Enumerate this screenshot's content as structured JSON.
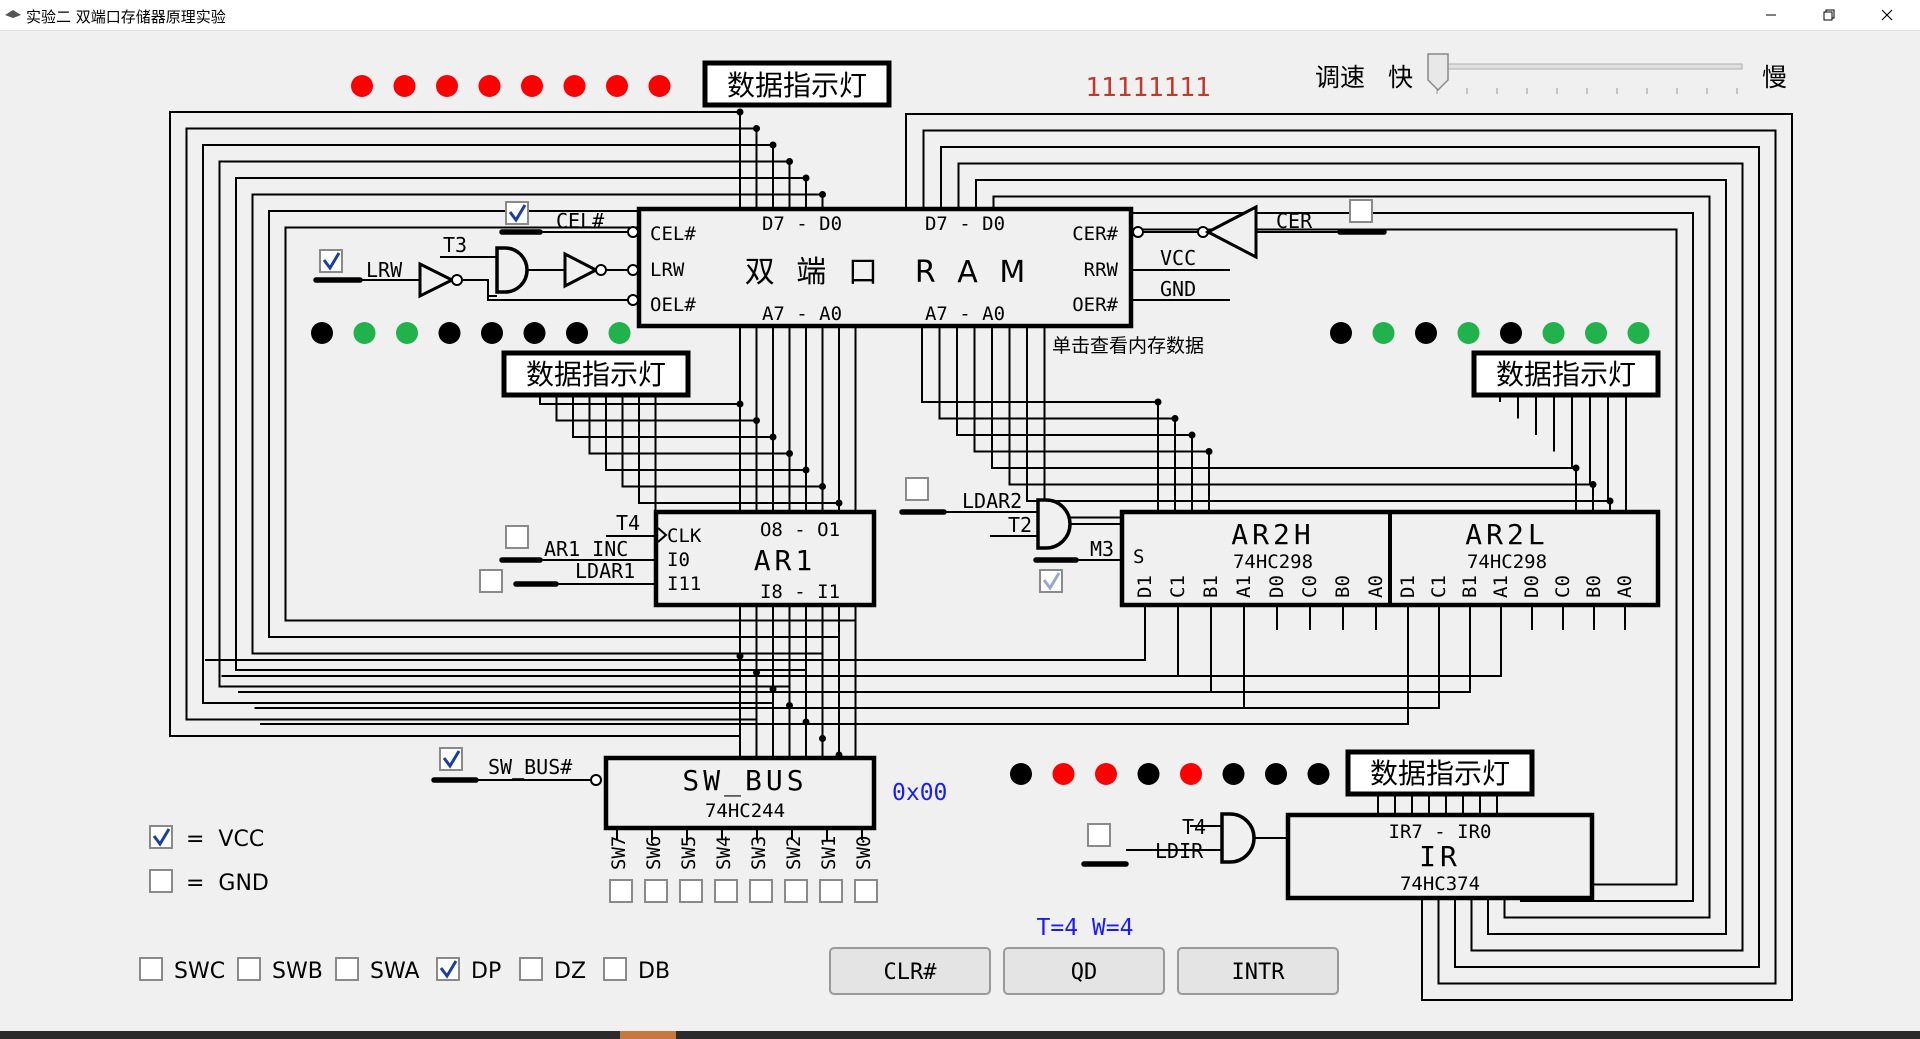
{
  "window": {
    "title": "实验二 双端口存储器原理实验",
    "controls": [
      "minimize",
      "maximize",
      "close"
    ],
    "icon": "app-icon"
  },
  "colors": {
    "led_red": "#ff0000",
    "led_green": "#22b24c",
    "led_off": "#000000",
    "value_red": "#c0392b",
    "value_blue": "#1a1aff",
    "check_blue": "#1a3fa0"
  },
  "speed": {
    "label": "调速",
    "fast": "快",
    "slow": "慢",
    "value": 0
  },
  "top_indicator": {
    "label": "数据指示灯",
    "leds": [
      "red",
      "red",
      "red",
      "red",
      "red",
      "red",
      "red",
      "red"
    ],
    "value": "11111111"
  },
  "left_indicator": {
    "label": "数据指示灯",
    "leds": [
      "off",
      "green",
      "green",
      "off",
      "off",
      "off",
      "off",
      "green"
    ]
  },
  "right_indicator": {
    "label": "数据指示灯",
    "leds": [
      "off",
      "green",
      "off",
      "green",
      "off",
      "green",
      "green",
      "green"
    ]
  },
  "ir_indicator": {
    "label": "数据指示灯",
    "leds": [
      "off",
      "red",
      "red",
      "off",
      "red",
      "off",
      "off",
      "off"
    ]
  },
  "ram": {
    "title": "双 端 口  R A M",
    "cel": "CEL#",
    "lrw": "LRW",
    "oel": "OEL#",
    "cer": "CER#",
    "rrw": "RRW",
    "oer": "OER#",
    "data_left": "D7 - D0",
    "data_right": "D7 - D0",
    "addr_left": "A7 - A0",
    "addr_right": "A7 - A0",
    "hint": "单击查看内存数据"
  },
  "left_controls": {
    "lrw": "LRW",
    "t3": "T3",
    "cel": "CEL#",
    "lrw_checked": true,
    "cel_checked": true
  },
  "right_controls": {
    "cer": "CER",
    "vcc": "VCC",
    "gnd": "GND",
    "cer_checked": false
  },
  "ar1": {
    "title": "AR1",
    "clk": "CLK",
    "i0": "I0",
    "i11": "I11",
    "outputs": "O8 - O1",
    "inputs": "I8 - I1",
    "t4": "T4",
    "inc": "AR1_INC",
    "ldar1": "LDAR1",
    "inc_checked": false,
    "ldar1_checked": false
  },
  "ar2": {
    "ldar2": "LDAR2",
    "t2": "T2",
    "m3": "M3",
    "s": "S",
    "ar2h": "AR2H",
    "ar2l": "AR2L",
    "chip": "74HC298",
    "pins": [
      "D1",
      "C1",
      "B1",
      "A1",
      "D0",
      "C0",
      "B0",
      "A0"
    ],
    "ldar2_checked": false,
    "m3_checked": true
  },
  "sw_bus": {
    "title": "SW_BUS",
    "chip": "74HC244",
    "control": "SW_BUS#",
    "control_checked": true,
    "value": "0x00",
    "switches": [
      "SW7",
      "SW6",
      "SW5",
      "SW4",
      "SW3",
      "SW2",
      "SW1",
      "SW0"
    ],
    "switch_states": [
      false,
      false,
      false,
      false,
      false,
      false,
      false,
      false
    ]
  },
  "ir": {
    "title": "IR",
    "chip": "74HC374",
    "outputs": "IR7 - IR0",
    "t4": "T4",
    "ldir": "LDIR",
    "ldir_checked": false
  },
  "legend": {
    "vcc": "=  VCC",
    "gnd": "=  GND"
  },
  "mode_switches": [
    {
      "label": "SWC",
      "checked": false
    },
    {
      "label": "SWB",
      "checked": false
    },
    {
      "label": "SWA",
      "checked": false
    },
    {
      "label": "DP",
      "checked": true
    },
    {
      "label": "DZ",
      "checked": false
    },
    {
      "label": "DB",
      "checked": false
    }
  ],
  "timing": "T=4 W=4",
  "buttons": {
    "clr": "CLR#",
    "qd": "QD",
    "intr": "INTR"
  }
}
